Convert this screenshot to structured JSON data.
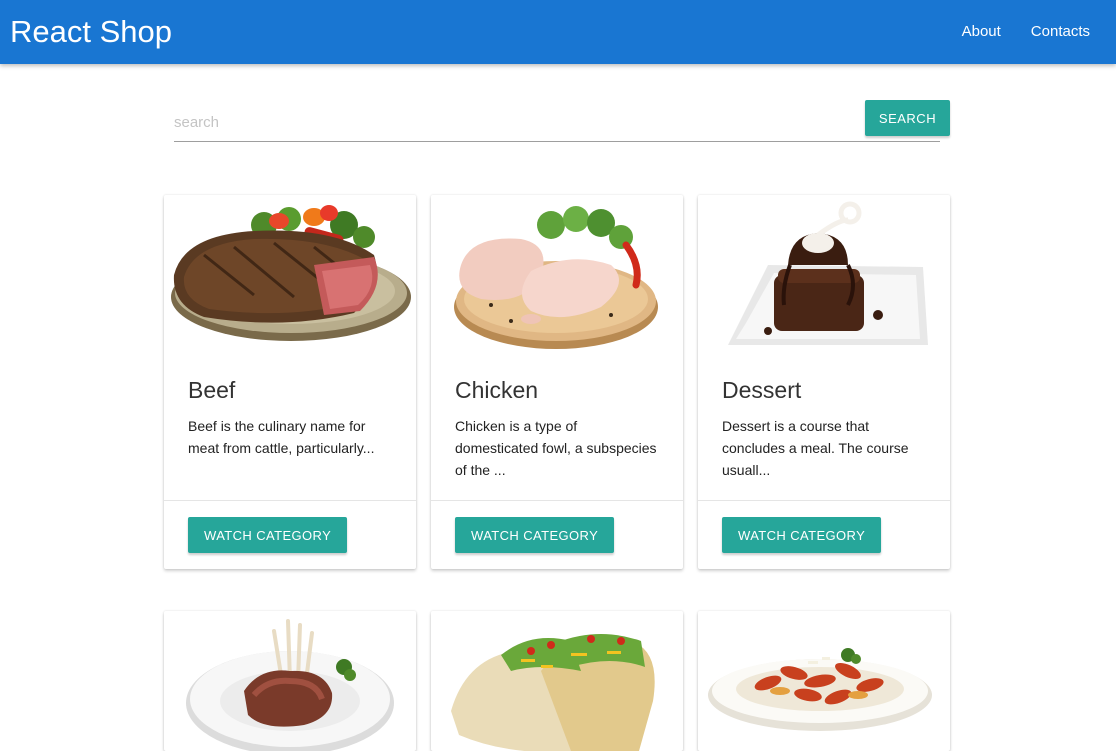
{
  "navbar": {
    "brand": "React Shop",
    "links": [
      "About",
      "Contacts"
    ],
    "color": "#1976d2"
  },
  "search": {
    "placeholder": "search",
    "value": "",
    "button_label": "SEARCH"
  },
  "accent_color": "#26a69a",
  "categories": [
    {
      "title": "Beef",
      "description": "Beef is the culinary name for meat from cattle, particularly...",
      "button_label": "WATCH CATEGORY",
      "image_icon": "beef-steak-image"
    },
    {
      "title": "Chicken",
      "description": "Chicken is a type of domesticated fowl, a subspecies of the ...",
      "button_label": "WATCH CATEGORY",
      "image_icon": "chicken-legs-image"
    },
    {
      "title": "Dessert",
      "description": "Dessert is a course that concludes a meal. The course usuall...",
      "button_label": "WATCH CATEGORY",
      "image_icon": "chocolate-cake-image"
    },
    {
      "image_icon": "lamb-chops-image"
    },
    {
      "image_icon": "tacos-image"
    },
    {
      "image_icon": "pasta-image"
    }
  ]
}
